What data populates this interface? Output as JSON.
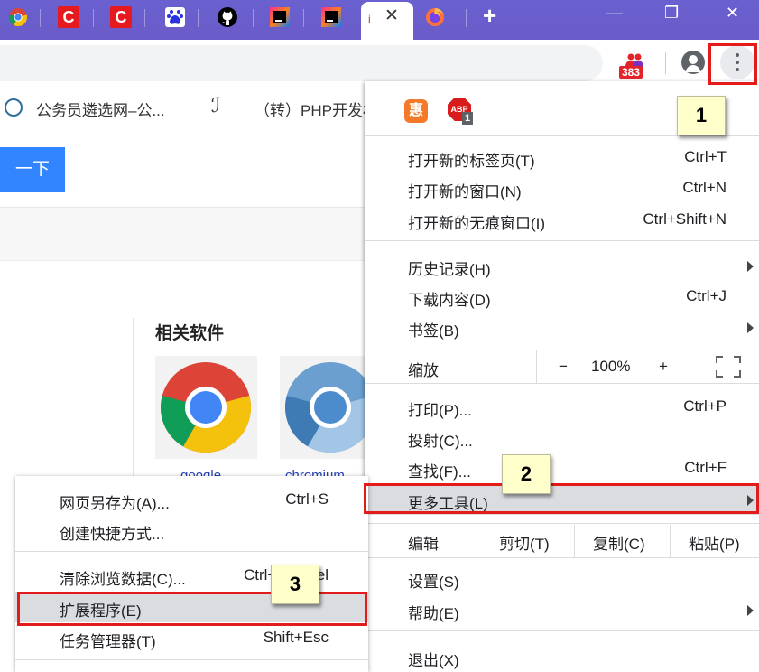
{
  "window": {
    "new_tab_symbol": "+",
    "close_tab_symbol": "✕",
    "minimize_symbol": "—",
    "restore_symbol": "❐",
    "close_window_symbol": "✕"
  },
  "tabs": [
    {
      "icon": "chrome-icon"
    },
    {
      "icon": "csdn-icon",
      "text": "C"
    },
    {
      "icon": "csdn-icon",
      "text": "C"
    },
    {
      "icon": "baidu-icon"
    },
    {
      "icon": "github-icon"
    },
    {
      "icon": "jetbrains-icon"
    },
    {
      "icon": "jetbrains-icon"
    },
    {
      "icon": "active-tab-favicon",
      "text": "i",
      "active": true
    },
    {
      "icon": "firefox-icon"
    }
  ],
  "toolbar": {
    "extension_badge_count": "383",
    "menu_dots": "⋮"
  },
  "bookmarks": [
    {
      "label": "公务员遴选网–公..."
    },
    {
      "label": "（转）PHP开发材"
    }
  ],
  "page": {
    "search_button_label": "一下",
    "related_software_title": "相关软件",
    "software": [
      {
        "name": "google"
      },
      {
        "name": "chromium"
      }
    ]
  },
  "menu": {
    "extensions": {
      "ext1_glyph": "惠",
      "ext2_glyph": "ABP",
      "ext2_badge": "1"
    },
    "group1": [
      {
        "label": "打开新的标签页(T)",
        "shortcut": "Ctrl+T"
      },
      {
        "label": "打开新的窗口(N)",
        "shortcut": "Ctrl+N"
      },
      {
        "label": "打开新的无痕窗口(I)",
        "shortcut": "Ctrl+Shift+N"
      }
    ],
    "group2": [
      {
        "label": "历史记录(H)",
        "shortcut": ""
      },
      {
        "label": "下载内容(D)",
        "shortcut": "Ctrl+J"
      },
      {
        "label": "书签(B)",
        "shortcut": ""
      }
    ],
    "zoom": {
      "label": "缩放",
      "minus": "−",
      "value": "100%",
      "plus": "+"
    },
    "group3": [
      {
        "label": "打印(P)...",
        "shortcut": "Ctrl+P"
      },
      {
        "label": "投射(C)...",
        "shortcut": ""
      },
      {
        "label": "查找(F)...",
        "shortcut": "Ctrl+F"
      },
      {
        "label": "更多工具(L)",
        "shortcut": ""
      }
    ],
    "edit": {
      "label": "编辑",
      "cut": "剪切(T)",
      "copy": "复制(C)",
      "paste": "粘贴(P)"
    },
    "group4": [
      {
        "label": "设置(S)",
        "shortcut": ""
      },
      {
        "label": "帮助(E)",
        "shortcut": ""
      }
    ],
    "exit": {
      "label": "退出(X)"
    }
  },
  "submenu": {
    "group1": [
      {
        "label": "网页另存为(A)...",
        "shortcut": "Ctrl+S"
      },
      {
        "label": "创建快捷方式...",
        "shortcut": ""
      }
    ],
    "group2": [
      {
        "label": "清除浏览数据(C)...",
        "shortcut": "Ctrl+Sh     el"
      },
      {
        "label": "扩展程序(E)",
        "shortcut": ""
      },
      {
        "label": "任务管理器(T)",
        "shortcut": "Shift+Esc"
      }
    ]
  },
  "callouts": [
    {
      "number": "1"
    },
    {
      "number": "2"
    },
    {
      "number": "3"
    }
  ],
  "colors": {
    "tabstrip": "#6a5cc9",
    "annotation_red": "#e31b1b",
    "callout_bg": "#ffffcc",
    "search_button": "#3385ff"
  }
}
